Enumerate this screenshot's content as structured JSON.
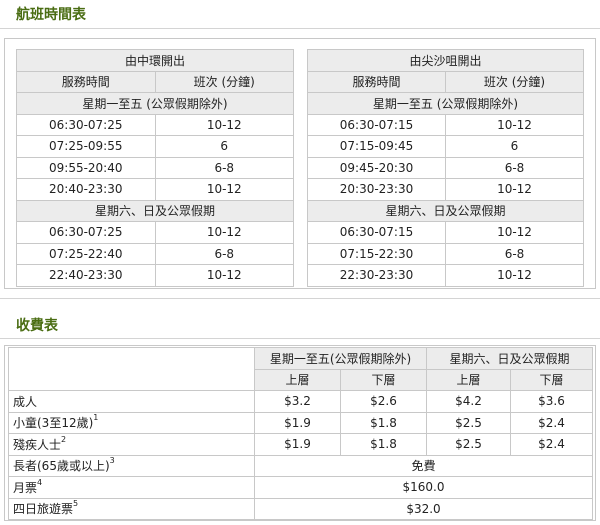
{
  "schedule": {
    "title": "航班時間表",
    "central": {
      "heading": "由中環開出",
      "col_time": "服務時間",
      "col_freq": "班次 (分鐘)",
      "weekday_heading": "星期一至五 (公眾假期除外)",
      "weekday_rows": [
        {
          "time": "06:30-07:25",
          "freq": "10-12"
        },
        {
          "time": "07:25-09:55",
          "freq": "6"
        },
        {
          "time": "09:55-20:40",
          "freq": "6-8"
        },
        {
          "time": "20:40-23:30",
          "freq": "10-12"
        }
      ],
      "weekend_heading": "星期六、日及公眾假期",
      "weekend_rows": [
        {
          "time": "06:30-07:25",
          "freq": "10-12"
        },
        {
          "time": "07:25-22:40",
          "freq": "6-8"
        },
        {
          "time": "22:40-23:30",
          "freq": "10-12"
        }
      ]
    },
    "tst": {
      "heading": "由尖沙咀開出",
      "col_time": "服務時間",
      "col_freq": "班次 (分鐘)",
      "weekday_heading": "星期一至五 (公眾假期除外)",
      "weekday_rows": [
        {
          "time": "06:30-07:15",
          "freq": "10-12"
        },
        {
          "time": "07:15-09:45",
          "freq": "6"
        },
        {
          "time": "09:45-20:30",
          "freq": "6-8"
        },
        {
          "time": "20:30-23:30",
          "freq": "10-12"
        }
      ],
      "weekend_heading": "星期六、日及公眾假期",
      "weekend_rows": [
        {
          "time": "06:30-07:15",
          "freq": "10-12"
        },
        {
          "time": "07:15-22:30",
          "freq": "6-8"
        },
        {
          "time": "22:30-23:30",
          "freq": "10-12"
        }
      ]
    }
  },
  "fares": {
    "title": "收費表",
    "weekday_heading": "星期一至五(公眾假期除外)",
    "weekend_heading": "星期六、日及公眾假期",
    "upper": "上層",
    "lower": "下層",
    "rows": [
      {
        "label": "成人",
        "sup": "",
        "wd_upper": "$3.2",
        "wd_lower": "$2.6",
        "we_upper": "$4.2",
        "we_lower": "$3.6"
      },
      {
        "label": "小童(3至12歲)",
        "sup": "1",
        "wd_upper": "$1.9",
        "wd_lower": "$1.8",
        "we_upper": "$2.5",
        "we_lower": "$2.4"
      },
      {
        "label": "殘疾人士",
        "sup": "2",
        "wd_upper": "$1.9",
        "wd_lower": "$1.8",
        "we_upper": "$2.5",
        "we_lower": "$2.4"
      }
    ],
    "span_rows": [
      {
        "label": "長者(65歲或以上)",
        "sup": "3",
        "value": "免費"
      },
      {
        "label": "月票",
        "sup": "4",
        "value": "$160.0"
      },
      {
        "label": "四日旅遊票",
        "sup": "5",
        "value": "$32.0"
      }
    ]
  }
}
